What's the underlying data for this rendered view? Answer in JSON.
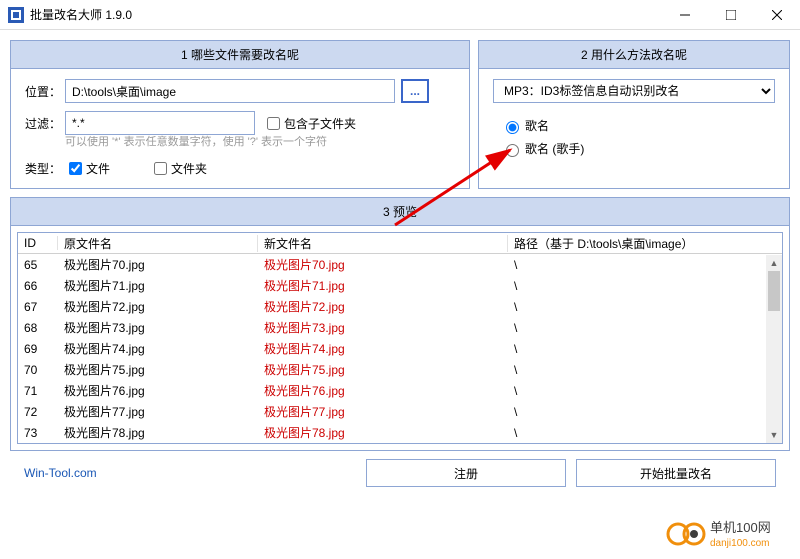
{
  "window": {
    "title": "批量改名大师 1.9.0"
  },
  "panels": {
    "left": "1 哪些文件需要改名呢",
    "right": "2 用什么方法改名呢",
    "preview": "3 预览"
  },
  "location": {
    "label": "位置：",
    "value": "D:\\tools\\桌面\\image",
    "browse": "..."
  },
  "filter": {
    "label": "过滤：",
    "value": "*.*",
    "include_sub_label": "包含子文件夹",
    "hint": "可以使用 '*' 表示任意数量字符，使用 '?' 表示一个字符"
  },
  "type": {
    "label": "类型：",
    "file_label": "文件",
    "folder_label": "文件夹"
  },
  "method": {
    "select_value": "MP3：ID3标签信息自动识别改名",
    "radio1": "歌名",
    "radio2": "歌名 (歌手)"
  },
  "table": {
    "headers": {
      "id": "ID",
      "orig": "原文件名",
      "newname": "新文件名",
      "path": "路径（基于 D:\\tools\\桌面\\image）"
    },
    "rows": [
      {
        "id": "65",
        "orig": "极光图片70.jpg",
        "newname": "极光图片70.jpg",
        "path": "\\"
      },
      {
        "id": "66",
        "orig": "极光图片71.jpg",
        "newname": "极光图片71.jpg",
        "path": "\\"
      },
      {
        "id": "67",
        "orig": "极光图片72.jpg",
        "newname": "极光图片72.jpg",
        "path": "\\"
      },
      {
        "id": "68",
        "orig": "极光图片73.jpg",
        "newname": "极光图片73.jpg",
        "path": "\\"
      },
      {
        "id": "69",
        "orig": "极光图片74.jpg",
        "newname": "极光图片74.jpg",
        "path": "\\"
      },
      {
        "id": "70",
        "orig": "极光图片75.jpg",
        "newname": "极光图片75.jpg",
        "path": "\\"
      },
      {
        "id": "71",
        "orig": "极光图片76.jpg",
        "newname": "极光图片76.jpg",
        "path": "\\"
      },
      {
        "id": "72",
        "orig": "极光图片77.jpg",
        "newname": "极光图片77.jpg",
        "path": "\\"
      },
      {
        "id": "73",
        "orig": "极光图片78.jpg",
        "newname": "极光图片78.jpg",
        "path": "\\"
      }
    ]
  },
  "footer": {
    "link": "Win-Tool.com",
    "register": "注册",
    "start": "开始批量改名"
  },
  "watermark": {
    "line1": "单机100网",
    "line2": "danji100.com"
  }
}
